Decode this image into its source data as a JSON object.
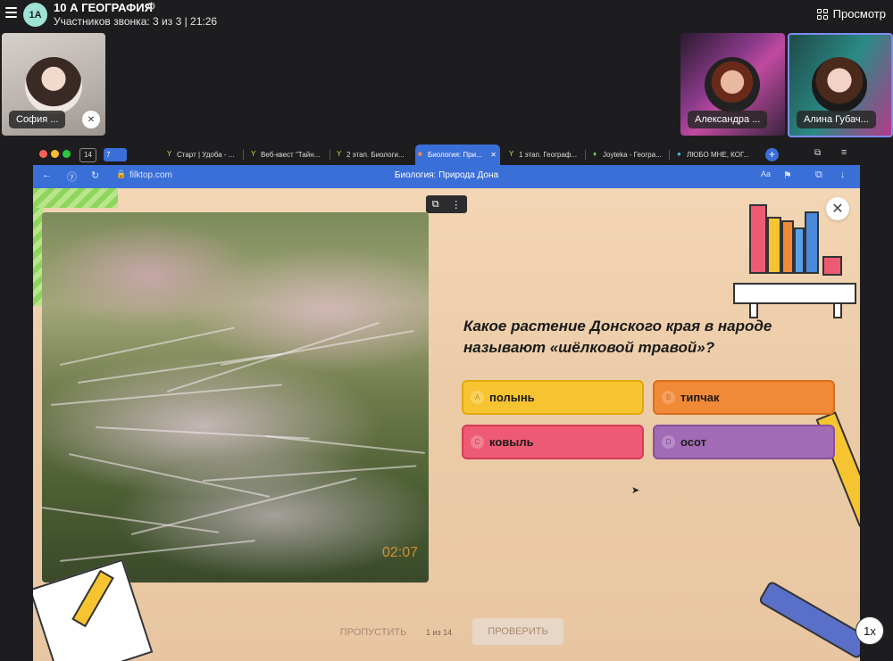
{
  "call": {
    "avatar_text": "1А",
    "title": "10 А ГЕОГРАФИЯ",
    "subtitle": "Участников звонка: 3 из 3 | 21:26",
    "view_label": "Просмотр"
  },
  "participants": [
    {
      "name": "София ..."
    },
    {
      "name": "Александра ..."
    },
    {
      "name": "Алина Губач..."
    }
  ],
  "browser": {
    "tab_counts": [
      "14",
      "7"
    ],
    "tabs": [
      {
        "label": "Старт | Удоба - ..."
      },
      {
        "label": "Веб-квест \"Тайн..."
      },
      {
        "label": "2 этап. Биологи..."
      },
      {
        "label": "Биология: При..."
      },
      {
        "label": "1 этап. Географ..."
      },
      {
        "label": "Joyteka - Геогра..."
      },
      {
        "label": "ЛЮБО МНЕ, КОГ..."
      }
    ],
    "url": "filktop.com",
    "page_title": "Биология: Природа Дона"
  },
  "quiz": {
    "timer": "02:07",
    "question": "Какое растение Донского края в народе называют «шёлковой травой»?",
    "options": [
      {
        "letter": "A",
        "label": "полынь"
      },
      {
        "letter": "B",
        "label": "типчак"
      },
      {
        "letter": "C",
        "label": "ковыль"
      },
      {
        "letter": "D",
        "label": "осот"
      }
    ],
    "skip_label": "ПРОПУСТИТЬ",
    "progress": "1 из 14",
    "check_label": "ПРОВЕРИТЬ"
  },
  "player": {
    "speed": "1x"
  },
  "colors": {
    "accent": "#3b6fd8",
    "option_a": "#f6c431",
    "option_b": "#f08a36",
    "option_c": "#ee5a74",
    "option_d": "#a16bb5"
  }
}
